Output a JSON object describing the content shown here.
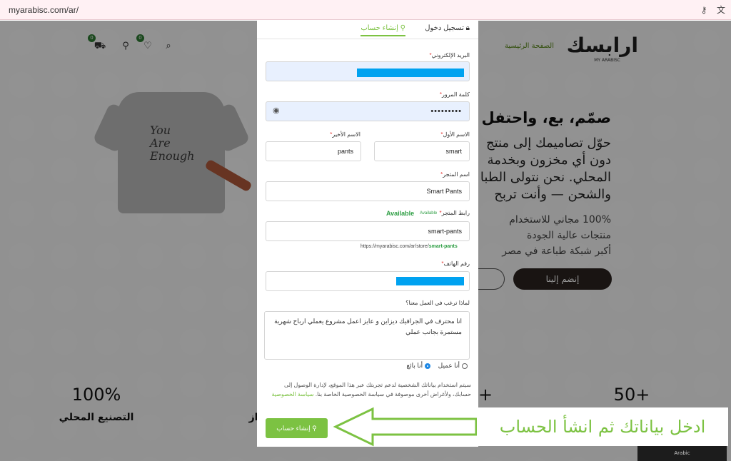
{
  "browser": {
    "url": "myarabisc.com/ar/"
  },
  "site": {
    "logo": "ارابسك",
    "logo_sub": "MY ARABISC",
    "nav_home": "الصفحة الرئيسية",
    "cart_count": "0",
    "wishlist_count": "0",
    "hero_title": "صمّم، بع، واحتفل ب",
    "hero_text": [
      "حوّل تصاميمك إلى منتج",
      "دون أي مخزون وبخدمة",
      "المحلي. نحن نتولى الطبا",
      "والشحن — وأنت تربح"
    ],
    "features": [
      "100% مجاني للاستخدام",
      "منتجات عالية الجودة",
      "أكبر شبكة طباعة في مصر"
    ],
    "join_label": "إنضم إلينا",
    "shirt_text": [
      "You",
      "Are",
      "Enough"
    ],
    "stats": [
      {
        "value": "100%",
        "label": "التصنيع المحلي"
      },
      {
        "value": "+",
        "label": "از"
      },
      {
        "value": "50+",
        "label": ""
      }
    ]
  },
  "modal": {
    "tab_login": "تسجيل دخول",
    "tab_register": "إنشاء حساب",
    "email_label": "البريد الإلكتروني",
    "password_label": "كلمة المرور",
    "password_value": "•••••••••",
    "first_name_label": "الاسم الأول",
    "first_name_value": "smart",
    "last_name_label": "الاسم الأخير",
    "last_name_value": "pants",
    "store_name_label": "اسم المتجر",
    "store_name_value": "Smart Pants",
    "store_link_label": "رابط المتجر",
    "available": "Available",
    "store_link_value": "smart-pants",
    "store_link_hint_prefix": "https://myarabisc.com/ar/store/",
    "store_link_hint_slug": "smart-pants",
    "phone_label": "رقم الهاتف",
    "why_label": "لماذا ترغب في العمل معنا؟",
    "why_value": "انا محترف في الجرافيك ديزاين و عايز اعمل مشروع يعملي ارباح شهرية مستمرة بجانب عملي",
    "role_customer": "أنا عميل",
    "role_seller": "أنا بائع",
    "privacy_text": "سيتم استخدام بياناتك الشخصية لدعم تجربتك عبر هذا الموقع، لإدارة الوصول إلى حسابك، ولأغراض أخرى موصوفة في سياسة الخصوصية الخاصة بنا.",
    "privacy_link": "سياسة الخصوصية",
    "submit_label": "إنشاء حساب"
  },
  "annotation": {
    "text": "ادخل بياناتك ثم انشأ الحساب"
  },
  "tooltip": "Arabic"
}
